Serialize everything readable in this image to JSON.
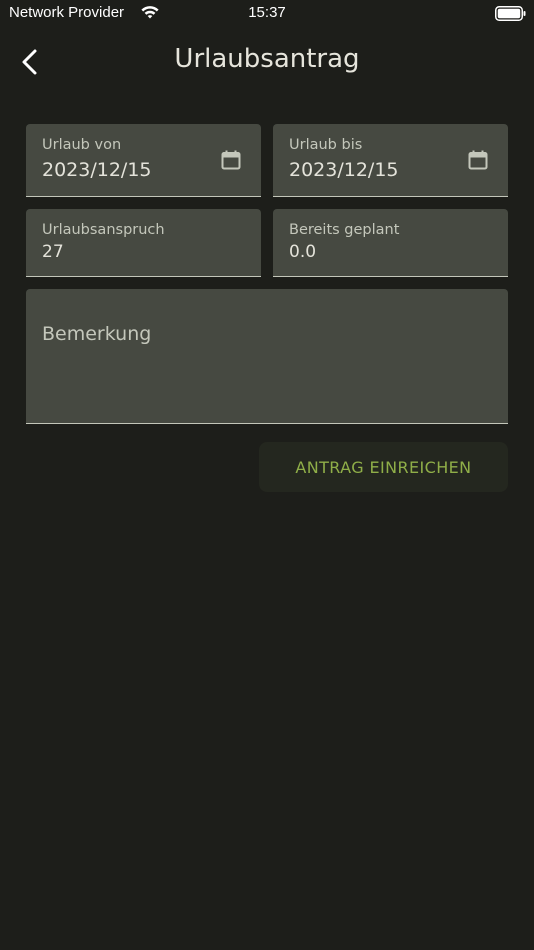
{
  "status_bar": {
    "carrier": "Network Provider",
    "time": "15:37",
    "wifi_icon": "wifi-icon",
    "battery_icon": "battery-icon"
  },
  "app_bar": {
    "title": "Urlaubsantrag",
    "back_icon": "chevron-left-icon"
  },
  "form": {
    "date_from": {
      "label": "Urlaub von",
      "value": "2023/12/15",
      "icon": "calendar-icon"
    },
    "date_to": {
      "label": "Urlaub bis",
      "value": "2023/12/15",
      "icon": "calendar-icon"
    },
    "entitlement": {
      "label": "Urlaubsanspruch",
      "value": "27"
    },
    "planned": {
      "label": "Bereits geplant",
      "value": "0.0"
    },
    "remark": {
      "placeholder": "Bemerkung",
      "value": ""
    },
    "submit_label": "ANTRAG EINREICHEN"
  },
  "colors": {
    "background": "#1d1e1a",
    "field_background": "#464941",
    "accent": "#8fae48",
    "button_background": "#24271f"
  }
}
